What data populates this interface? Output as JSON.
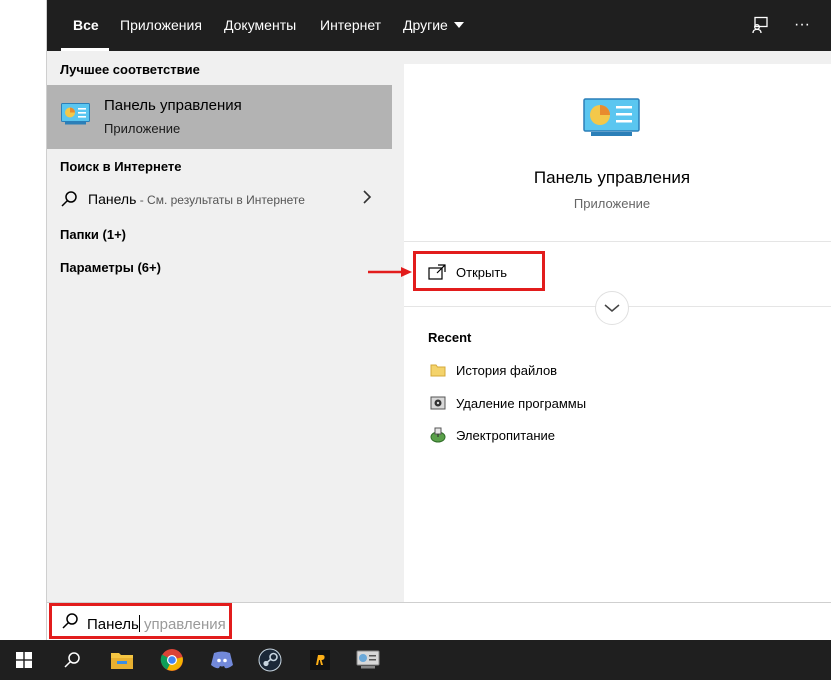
{
  "tabs": {
    "all": "Все",
    "apps": "Приложения",
    "documents": "Документы",
    "web": "Интернет",
    "other": "Другие"
  },
  "tabbar_icons": [
    "feedback-icon",
    "more-icon"
  ],
  "more_label": "···",
  "sections": {
    "best_match": "Лучшее соответствие",
    "web_search": "Поиск в Интернете",
    "folders": "Папки (1+)",
    "settings": "Параметры (6+)"
  },
  "best_result": {
    "title": "Панель управления",
    "subtitle": "Приложение"
  },
  "web_result": {
    "query": "Панель",
    "suffix": " - См. результаты в Интернете"
  },
  "details": {
    "title": "Панель управления",
    "subtitle": "Приложение",
    "open_label": "Открыть",
    "recent_title": "Recent",
    "recent_items": [
      "История файлов",
      "Удаление программы",
      "Электропитание"
    ]
  },
  "search": {
    "typed": "Панель",
    "hint": " управления"
  },
  "colors": {
    "accent": "#0078d7",
    "highlight_box": "#e21c1c",
    "selected_row": "#b3b3b3",
    "taskbar": "#1f1f1f"
  },
  "taskbar_icons": [
    "windows-start-icon",
    "search-icon",
    "file-explorer-icon",
    "chrome-icon",
    "discord-icon",
    "steam-icon",
    "rockstar-icon",
    "control-panel-icon"
  ]
}
